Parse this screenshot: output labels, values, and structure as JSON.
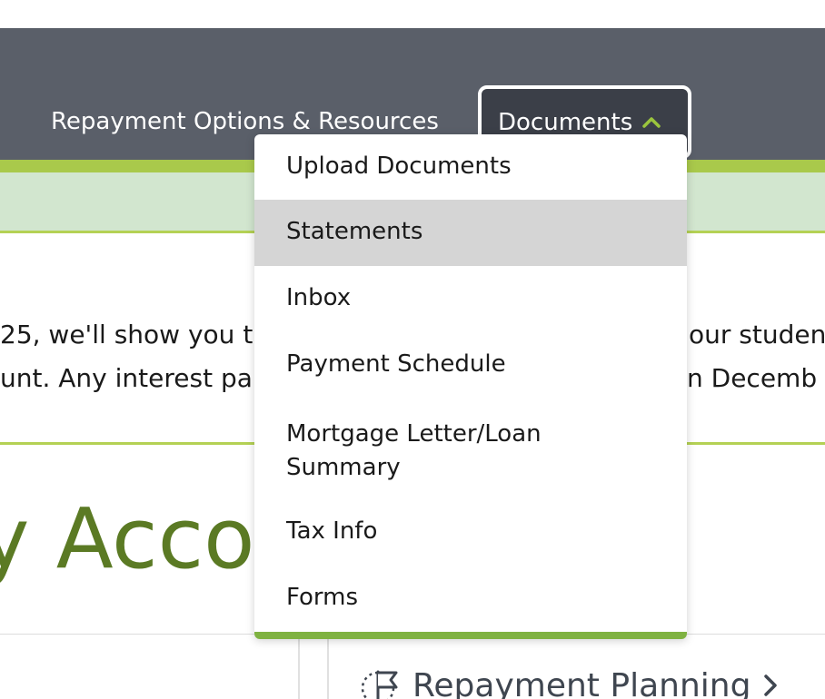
{
  "nav": {
    "repayment_label": "Repayment Options & Resources",
    "documents_label": "Documents",
    "documents_icon": "chevron-up-icon",
    "accent": "#9bc53d"
  },
  "dropdown": {
    "items": [
      {
        "label": "Upload Documents"
      },
      {
        "label": "Statements"
      },
      {
        "label": "Inbox"
      },
      {
        "label": "Payment Schedule"
      },
      {
        "label": "Mortgage Letter/Loan",
        "label2": "Summary"
      },
      {
        "label": "Tax Info"
      },
      {
        "label": "Forms"
      }
    ],
    "hovered": "Statements"
  },
  "notice": {
    "line1_left": "25, we'll show you t",
    "line1_right": "our student",
    "line2_left": "unt. Any interest pa",
    "line2_right": "n Decemb"
  },
  "page": {
    "title_fragment": "y Accou"
  },
  "cards": {
    "planning_label": "Repayment Planning",
    "planning_icon": "flag-icon"
  }
}
